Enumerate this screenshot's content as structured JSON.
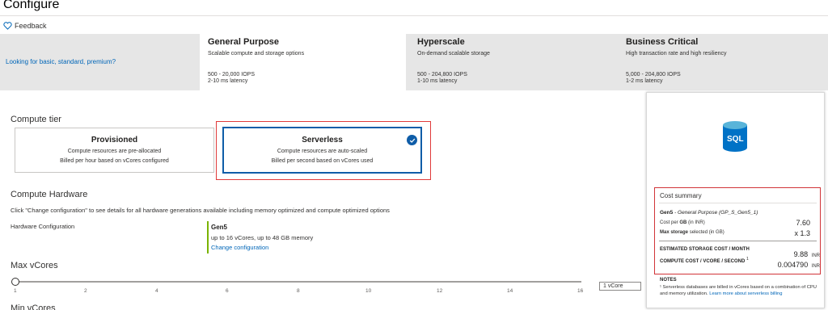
{
  "header": {
    "title": "Configure",
    "feedback_label": "Feedback"
  },
  "tiers": {
    "link": "Looking for basic, standard, premium?",
    "items": [
      {
        "name": "General Purpose",
        "desc": "Scalable compute and storage options",
        "iops": "500 - 20,000 IOPS",
        "latency": "2-10 ms latency",
        "selected": true
      },
      {
        "name": "Hyperscale",
        "desc": "On-demand scalable storage",
        "iops": "500 - 204,800 IOPS",
        "latency": "1-10 ms latency",
        "selected": false
      },
      {
        "name": "Business Critical",
        "desc": "High transaction rate and high resiliency",
        "iops": "5,000 - 204,800 IOPS",
        "latency": "1-2 ms latency",
        "selected": false
      }
    ]
  },
  "compute_tier": {
    "label": "Compute tier",
    "options": [
      {
        "title": "Provisioned",
        "line1": "Compute resources are pre-allocated",
        "line2": "Billed per hour based on vCores configured",
        "selected": false
      },
      {
        "title": "Serverless",
        "line1": "Compute resources are auto-scaled",
        "line2": "Billed per second based on vCores used",
        "selected": true
      }
    ]
  },
  "hardware": {
    "title": "Compute Hardware",
    "desc": "Click \"Change configuration\" to see details for all hardware generations available including memory optimized and compute optimized options",
    "config_label": "Hardware Configuration",
    "gen": "Gen5",
    "spec": "up to 16 vCores, up to 48 GB memory",
    "change_link": "Change configuration"
  },
  "max_vcores": {
    "label": "Max vCores",
    "ticks": [
      "1",
      "2",
      "4",
      "6",
      "8",
      "10",
      "12",
      "14",
      "16"
    ],
    "value_text": "1 vCore",
    "value": 1
  },
  "min_vcores": {
    "label": "Min vCores"
  },
  "cost_summary": {
    "sql_label": "SQL",
    "title": "Cost summary",
    "gen_bold": "Gen5",
    "gen_italic": " - General Purpose (GP_S_Gen5_1)",
    "cost_per_gb_label": "Cost per",
    "cost_per_gb_bold": "GB",
    "cost_per_gb_unit": "(in INR)",
    "cost_per_gb_value": "7.60",
    "max_storage_bold": "Max storage",
    "max_storage_unit": "selected (in GB)",
    "max_storage_value": "x 1.3",
    "est_storage_label": "ESTIMATED STORAGE COST / MONTH",
    "est_storage_value": "9.88",
    "est_storage_currency": "INR",
    "compute_cost_label": "COMPUTE COST / VCORE / SECOND",
    "compute_cost_sup": "1",
    "compute_cost_value": "0.004790",
    "compute_cost_currency": "INR",
    "notes_title": "NOTES",
    "note_text": "¹ Serverless databases are billed in vCores based on a combination of CPU and memory utilization.",
    "note_link": "Learn more about serverless billing"
  },
  "colors": {
    "accent": "#0f5da8",
    "highlight_red": "#e03a3a",
    "link": "#0066b8",
    "gen_bar": "#7ab300"
  }
}
